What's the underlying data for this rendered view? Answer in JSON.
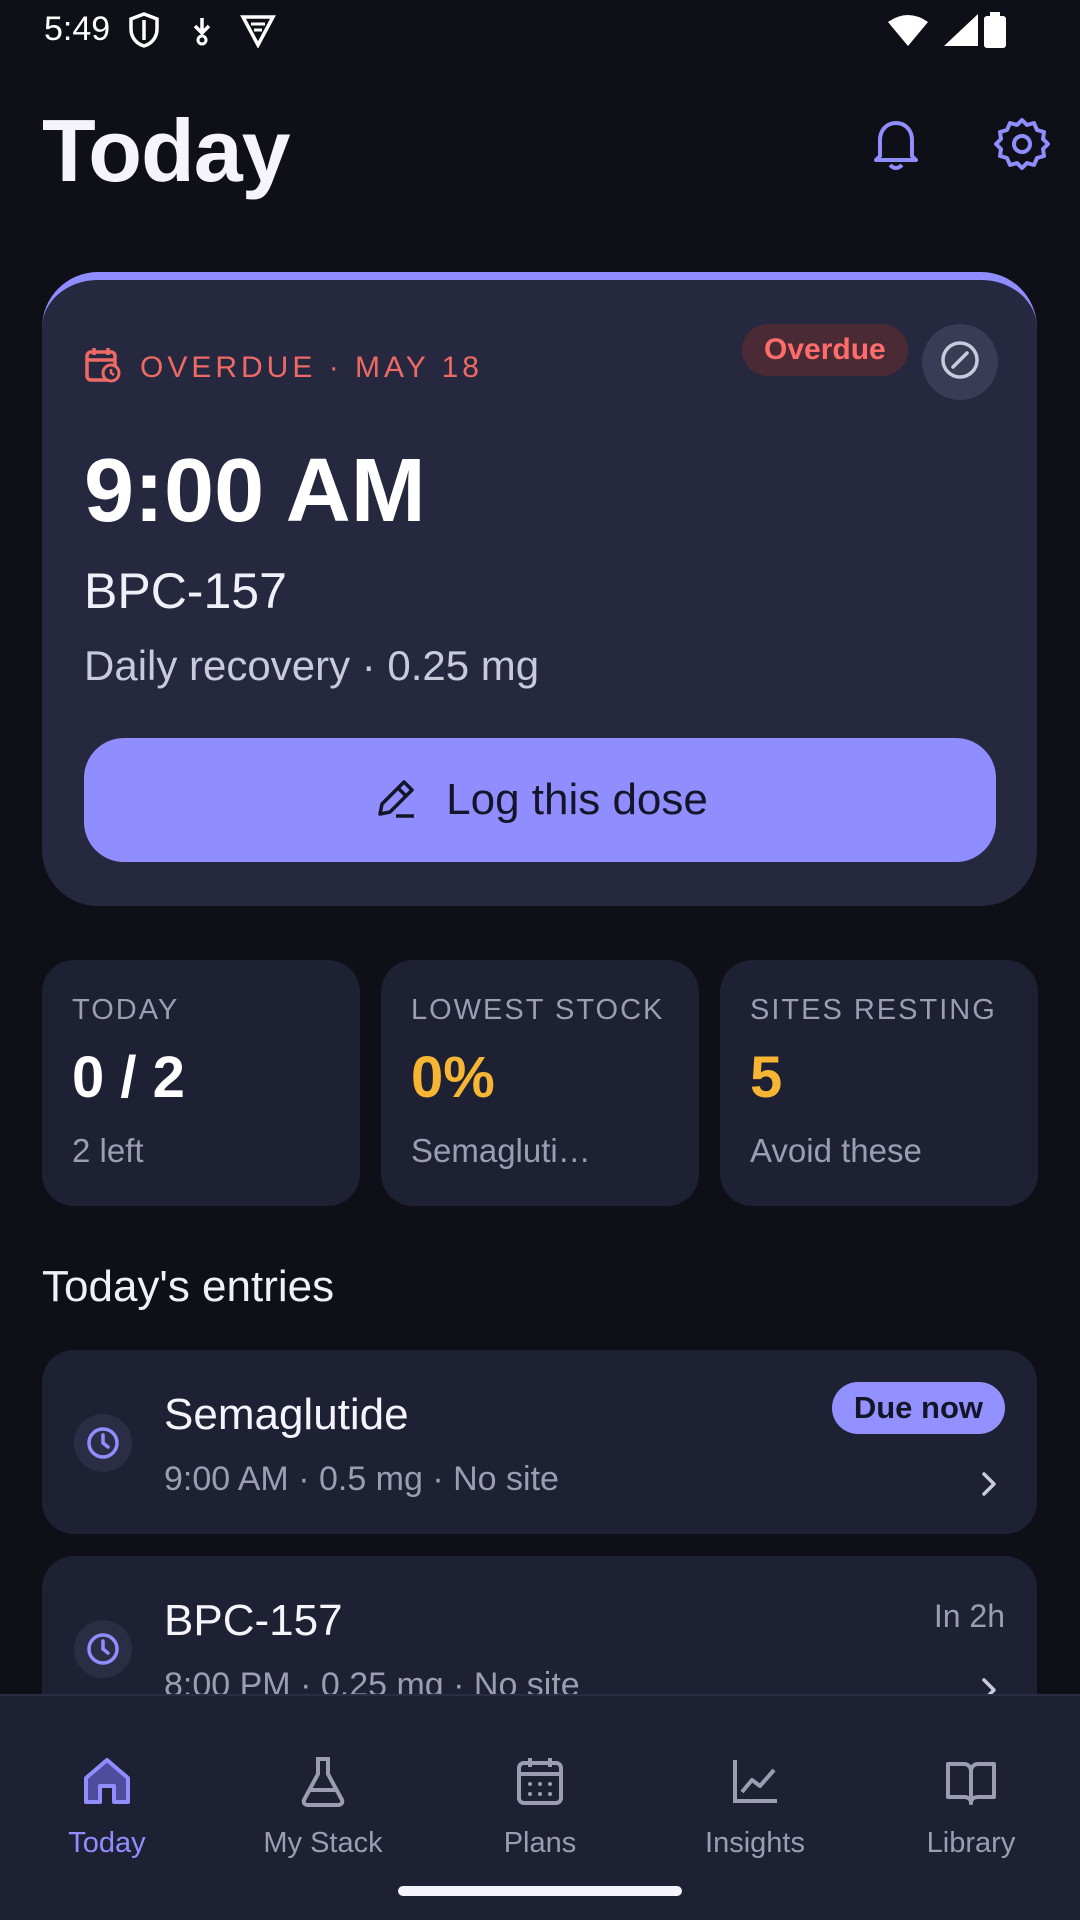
{
  "status_bar": {
    "time": "5:49",
    "left_icons": [
      "shield-icon",
      "download-icon",
      "vpn-icon"
    ],
    "right_icons": [
      "wifi-icon",
      "signal-icon",
      "battery-icon"
    ]
  },
  "header": {
    "title": "Today",
    "icons": [
      "bell-icon",
      "gear-icon"
    ]
  },
  "hero": {
    "status_line": "OVERDUE · MAY 18",
    "badge": "Overdue",
    "time": "9:00 AM",
    "compound": "BPC-157",
    "detail": "Daily recovery · 0.25 mg",
    "button_label": "Log this dose",
    "accent": "#8f8dff",
    "alert_color": "#ef6a64"
  },
  "stats": [
    {
      "label": "TODAY",
      "value": "0 / 2",
      "sub": "2 left",
      "value_color": "#ffffff"
    },
    {
      "label": "LOWEST STOCK",
      "value": "0%",
      "sub": "Semagluti…",
      "value_color": "#f6b634"
    },
    {
      "label": "SITES RESTING",
      "value": "5",
      "sub": "Avoid these",
      "value_color": "#f6b634"
    }
  ],
  "entries": {
    "title": "Today's entries",
    "items": [
      {
        "name": "Semaglutide",
        "detail": "9:00 AM · 0.5 mg · No site",
        "status": "Due now"
      },
      {
        "name": "BPC-157",
        "detail": "8:00 PM · 0.25 mg · No site",
        "status": "In 2h"
      }
    ]
  },
  "nav": {
    "items": [
      {
        "label": "Today",
        "icon": "home-icon",
        "active": true
      },
      {
        "label": "My Stack",
        "icon": "flask-icon",
        "active": false
      },
      {
        "label": "Plans",
        "icon": "calendar-icon",
        "active": false
      },
      {
        "label": "Insights",
        "icon": "chart-icon",
        "active": false
      },
      {
        "label": "Library",
        "icon": "book-icon",
        "active": false
      }
    ]
  }
}
